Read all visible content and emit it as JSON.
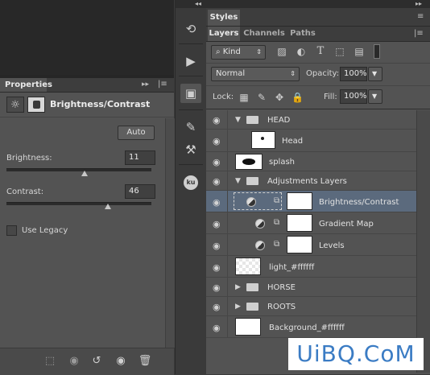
{
  "properties": {
    "tab": "Properties",
    "adjustment_title": "Brightness/Contrast",
    "auto_label": "Auto",
    "brightness_label": "Brightness:",
    "brightness_value": "11",
    "brightness_fraction": 0.54,
    "contrast_label": "Contrast:",
    "contrast_value": "46",
    "contrast_fraction": 0.7,
    "legacy_label": "Use Legacy",
    "legacy_checked": false
  },
  "styles_tab": "Styles",
  "layers_panel": {
    "tabs": [
      "Layers",
      "Channels",
      "Paths"
    ],
    "filter_kind": "Kind",
    "blend_mode": "Normal",
    "opacity_label": "Opacity:",
    "opacity_value": "100%",
    "lock_label": "Lock:",
    "fill_label": "Fill:",
    "fill_value": "100%",
    "layers": [
      {
        "name": "HEAD",
        "type": "group",
        "expanded": true
      },
      {
        "name": "Head",
        "type": "layer"
      },
      {
        "name": "splash",
        "type": "layer"
      },
      {
        "name": "Adjustments Layers",
        "type": "group",
        "expanded": true
      },
      {
        "name": "Brightness/Contrast",
        "type": "adjustment",
        "selected": true
      },
      {
        "name": "Gradient Map",
        "type": "adjustment"
      },
      {
        "name": "Levels",
        "type": "adjustment"
      },
      {
        "name": "light_#ffffff",
        "type": "layer"
      },
      {
        "name": "HORSE",
        "type": "group",
        "expanded": false
      },
      {
        "name": "ROOTS",
        "type": "group",
        "expanded": false
      },
      {
        "name": "Background_#ffffff",
        "type": "layer"
      }
    ]
  },
  "watermark": "UiBQ.CoM"
}
